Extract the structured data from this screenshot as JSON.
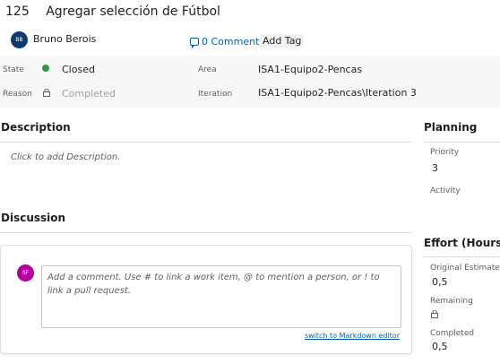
{
  "work_item": {
    "id": "125",
    "title": "Agregar selección de Fútbol",
    "author": {
      "initials": "BB",
      "name": "Bruno Berois"
    },
    "comments_link": "0 Comments",
    "add_tag_label": "Add Tag"
  },
  "fields": {
    "state_label": "State",
    "state_value": "Closed",
    "state_color": "#339947",
    "reason_label": "Reason",
    "reason_value": "Completed",
    "area_label": "Area",
    "area_value": "ISA1-Equipo2-Pencas",
    "iteration_label": "Iteration",
    "iteration_value": "ISA1-Equipo2-Pencas\\Iteration 3"
  },
  "description": {
    "title": "Description",
    "placeholder": "Click to add Description."
  },
  "discussion": {
    "title": "Discussion",
    "avatar_initials": "SF",
    "comment_placeholder": "Add a comment. Use # to link a work item, @ to mention a person, or ! to link a pull request.",
    "markdown_link": "switch to Markdown editor"
  },
  "planning": {
    "title": "Planning",
    "priority_label": "Priority",
    "priority_value": "3",
    "activity_label": "Activity"
  },
  "effort": {
    "title": "Effort (Hours)",
    "original_estimate_label": "Original Estimate",
    "original_estimate_value": "0,5",
    "remaining_label": "Remaining",
    "completed_label": "Completed",
    "completed_value": "0,5"
  },
  "colors": {
    "link": "#0063b1",
    "author_avatar": "#0d3a6e",
    "commenter_avatar": "#b4009e"
  }
}
